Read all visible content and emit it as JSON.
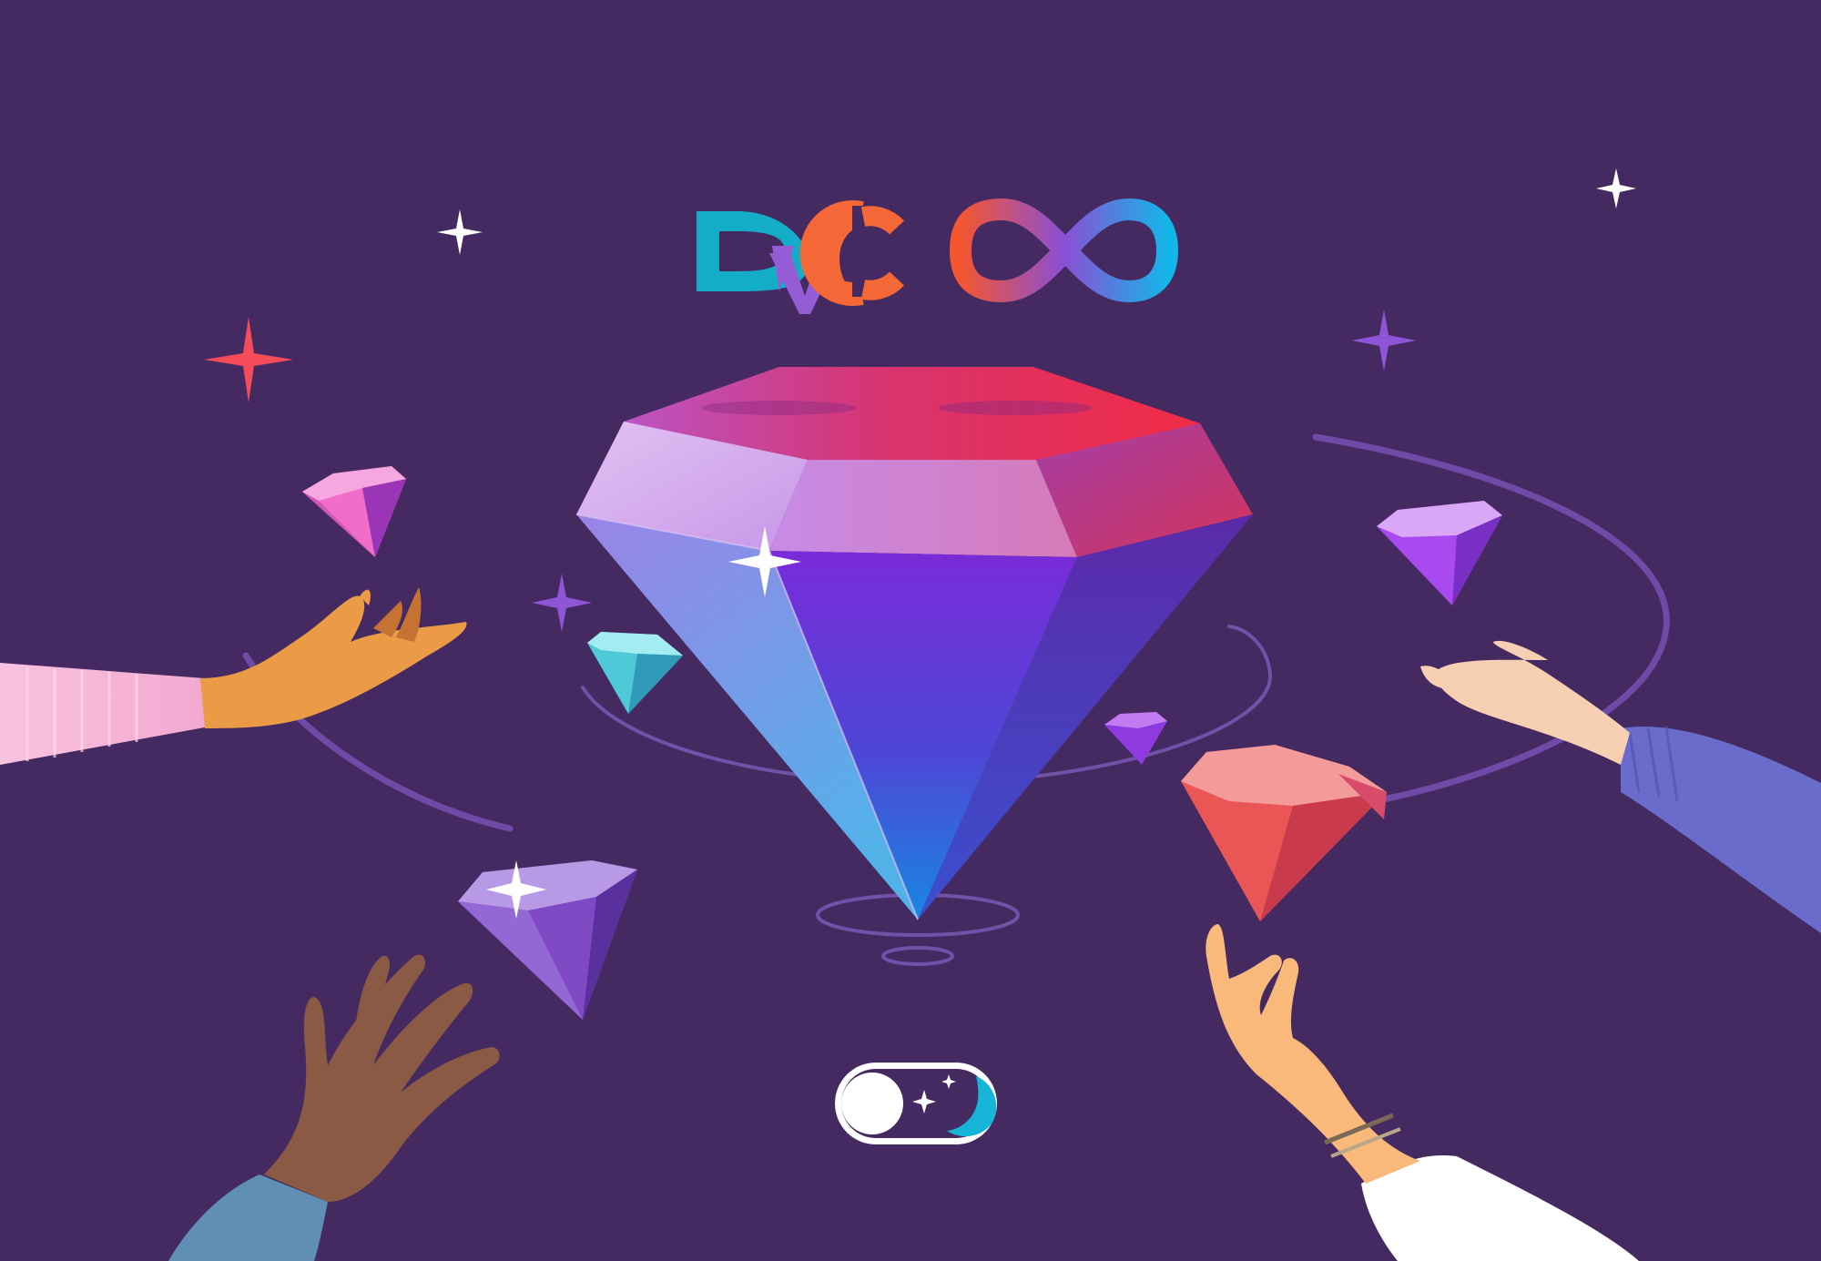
{
  "logos": {
    "dvc": {
      "letters": [
        "D",
        "V",
        "C"
      ]
    },
    "infinity": {
      "shape": "infinity-loop"
    }
  },
  "toggle": {
    "state": "off",
    "mode_icons": [
      "sparkle-icon",
      "crescent-moon-icon"
    ]
  },
  "colors": {
    "background": "#452a62",
    "dvc_d": "#13adc7",
    "dvc_v": "#945dd6",
    "dvc_c": "#f46737",
    "orbit": "#6e4ba6",
    "sparkle_red": "#f54c5a",
    "sparkle_purple": "#8f55d6",
    "sparkle_white": "#ffffff"
  },
  "icons": [
    "sparkle-icon",
    "diamond-gem",
    "hand",
    "toggle-switch",
    "crescent-moon-icon"
  ]
}
